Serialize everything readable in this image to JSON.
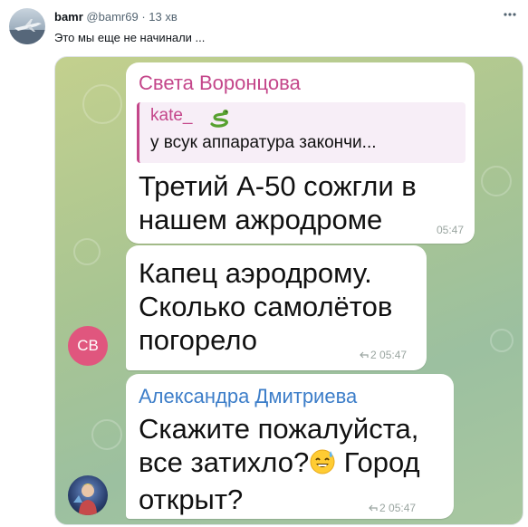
{
  "tweet": {
    "display_name": "bamr",
    "handle": "@bamr69",
    "separator": "·",
    "time_ago": "13 хв",
    "text": "Это мы еще не начинали ...",
    "more_icon": "more-horizontal-icon"
  },
  "screenshot": {
    "messages": [
      {
        "sender": "Света Воронцова",
        "sender_color": "#c4468a",
        "quote_author": "kate_",
        "quote_emoji": "snake-emoji",
        "quote_text": "у всук аппаратура закончи...",
        "lines": [
          "Третий А-50 сожгли в",
          "нашем ажродроме"
        ],
        "time": "05:47"
      },
      {
        "lines": [
          "Капец аэродрому.",
          "Сколько самолётов",
          "погорело"
        ],
        "replies": "2",
        "time": "05:47",
        "avatar_initials": "СВ",
        "avatar_color": "#e0567e"
      },
      {
        "sender": "Александра Дмитриева",
        "sender_color": "#3d7ec9",
        "line1": "Скажите пожалуйста,",
        "line2_a": "все затихло?",
        "line2_emoji": "grinning-sweat-emoji",
        "line2_b": " Город",
        "line3": "открыт?",
        "replies": "2",
        "time": "05:47"
      }
    ]
  }
}
